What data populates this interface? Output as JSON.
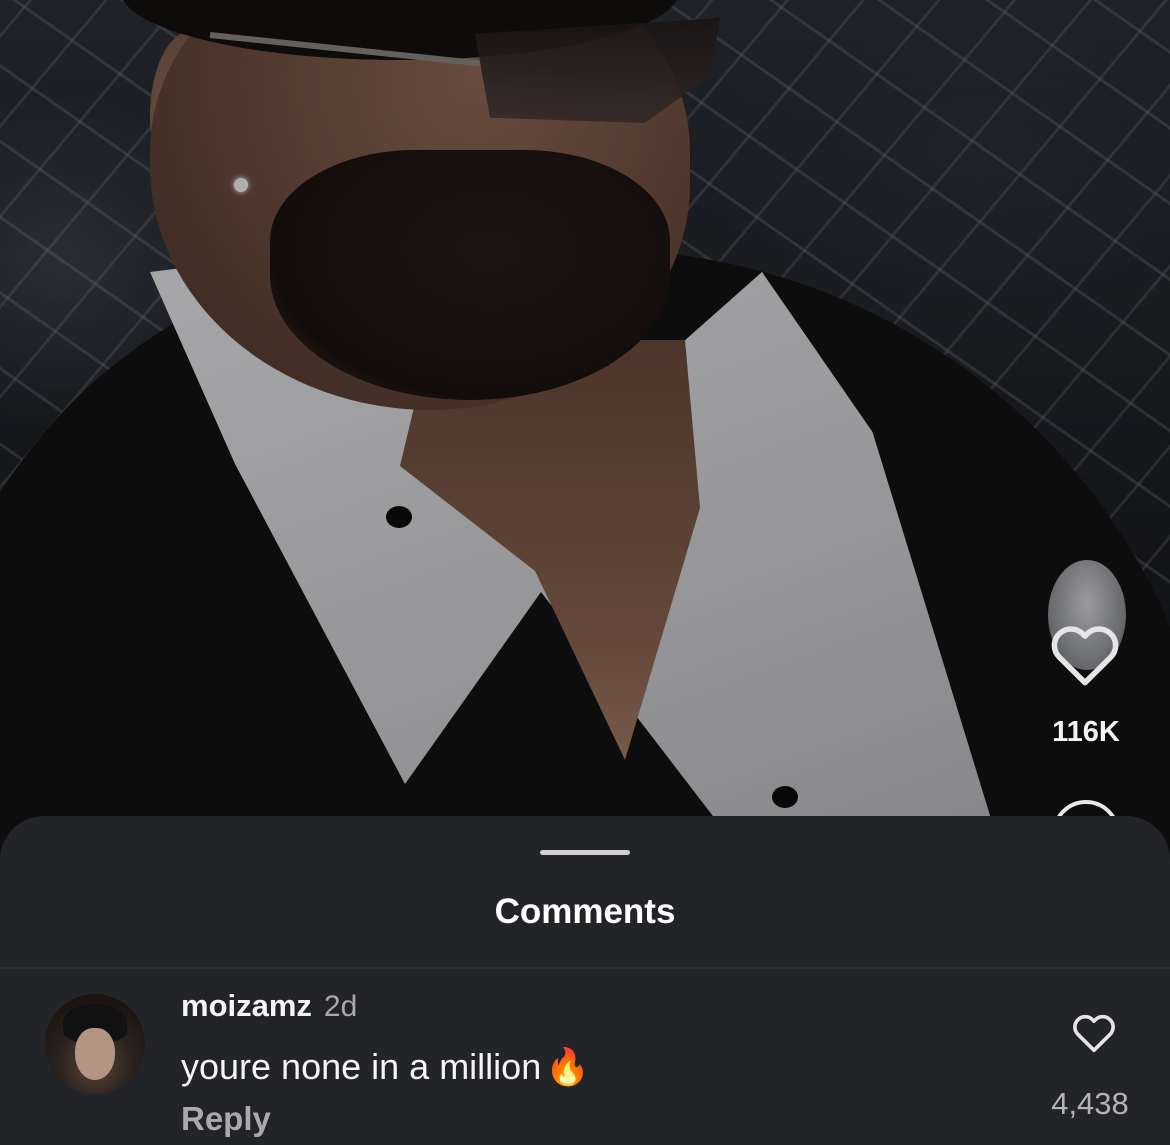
{
  "post": {
    "like_count": "116K",
    "like_icon": "heart-outline-icon"
  },
  "comments_sheet": {
    "title": "Comments",
    "items": [
      {
        "username": "moizamz",
        "time": "2d",
        "text": "youre none in a million",
        "emoji": "🔥",
        "reply_label": "Reply",
        "like_count": "4,438"
      }
    ]
  },
  "colors": {
    "sheet_background": "#232428",
    "primary_text": "#f5f5f5",
    "secondary_text": "#a9a9ae"
  }
}
